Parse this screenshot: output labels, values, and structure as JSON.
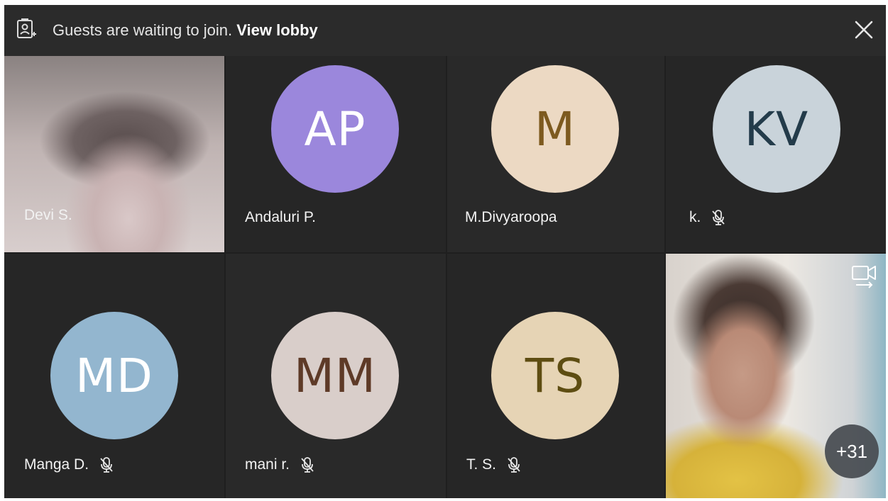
{
  "banner": {
    "message": "Guests are waiting to join.",
    "action": "View lobby"
  },
  "participants": [
    {
      "name": "Devi S.",
      "type": "video"
    },
    {
      "name": "Andaluri P.",
      "initials": "AP",
      "avatar_bg": "#9b87dc",
      "initials_color": "#ffffff",
      "muted": false
    },
    {
      "name": "M.Divyaroopa",
      "initials": "M",
      "avatar_bg": "#ecd9c3",
      "initials_color": "#7d5a1f",
      "muted": false
    },
    {
      "name": "k.",
      "initials": "KV",
      "avatar_bg": "#c9d3da",
      "initials_color": "#233b4a",
      "muted": true
    },
    {
      "name": "Manga D.",
      "initials": "MD",
      "avatar_bg": "#93b6cf",
      "initials_color": "#ffffff",
      "muted": true
    },
    {
      "name": "mani r.",
      "initials": "MM",
      "avatar_bg": "#d9ceca",
      "initials_color": "#5e3a27",
      "muted": true
    },
    {
      "name": "T. S.",
      "initials": "TS",
      "avatar_bg": "#e6d4b5",
      "initials_color": "#5e4d12",
      "muted": true
    }
  ],
  "self_view": {
    "type": "video"
  },
  "overflow_count": "+31",
  "icons": {
    "lobby": "lobby-icon",
    "close": "close-icon",
    "mic_off": "mic-off-icon",
    "switch_camera": "switch-camera-icon"
  }
}
